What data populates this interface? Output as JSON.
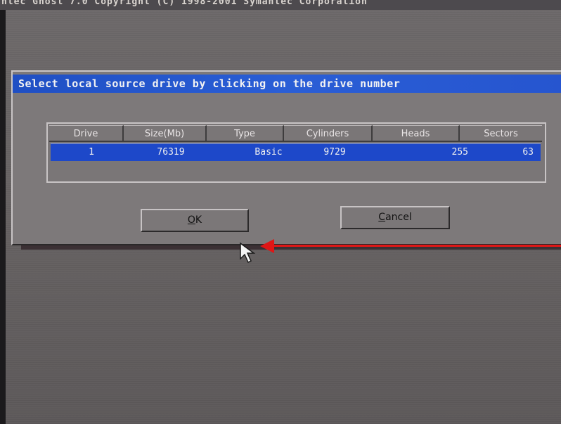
{
  "header": {
    "text": "ntec Ghost 7.0   Copyright (C) 1998-2001 Symantec Corporation"
  },
  "dialog": {
    "title": "Select local source drive by clicking on the drive number",
    "columns": [
      "Drive",
      "Size(Mb)",
      "Type",
      "Cylinders",
      "Heads",
      "Sectors"
    ],
    "rows": [
      {
        "drive": "1",
        "size": "76319",
        "type": "Basic",
        "cylinders": "9729",
        "heads": "255",
        "sectors": "63"
      }
    ],
    "ok_label_mnemonic": "O",
    "ok_label_rest": "K",
    "cancel_label_mnemonic": "C",
    "cancel_label_rest": "ancel"
  },
  "colors": {
    "title_bar": "#2a5ed6",
    "selected_row": "#1d48c9",
    "dialog_bg": "#7d797a",
    "annotation_arrow": "#e01616"
  },
  "icons": [
    "mouse-pointer-icon",
    "red-arrow-annotation"
  ]
}
